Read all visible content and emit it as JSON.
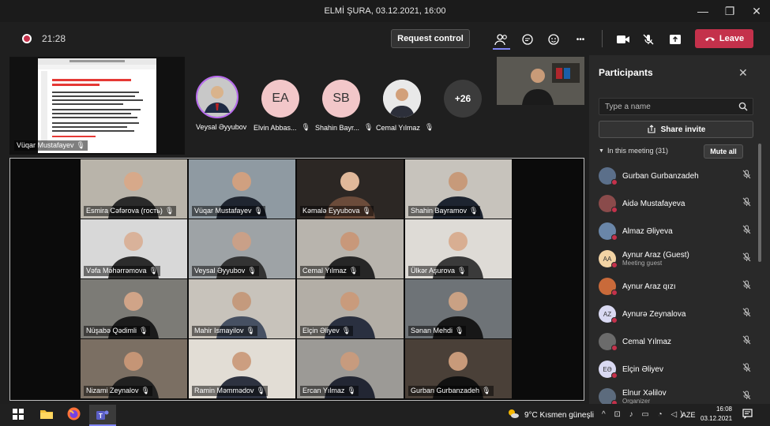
{
  "window": {
    "title": "ELMİ ŞURA, 03.12.2021, 16:00"
  },
  "toolbar": {
    "timer": "21:28",
    "request_control": "Request control",
    "more": "•••",
    "leave": "Leave"
  },
  "share": {
    "presenter": "Vüqar Mustafayev"
  },
  "top_row": [
    {
      "name": "Veysal Əyyubov"
    },
    {
      "initials": "EA",
      "name": "Elvin Abbas..."
    },
    {
      "initials": "SB",
      "name": "Shahin Bayr..."
    },
    {
      "name": "Cemal Yılmaz"
    }
  ],
  "overflow_count": "+26",
  "grid": [
    "Esmira Cəfərova (гость)",
    "Vüqar Mustafayev",
    "Kəmalə Eyyubova",
    "Shahin Bayramov",
    "Vəfa Məhərrəmova",
    "Veysal Əyyubov",
    "Cemal Yılmaz",
    "Ülkər Aşurova",
    "Nüşabə Qədimli",
    "Mahir Ismayilov",
    "Elçin Əliyev",
    "Sənan Mehdi",
    "Nizami Zeynalov",
    "Ramin Məmmədov",
    "Ercan Yılmaz",
    "Gurban Gurbanzadeh"
  ],
  "panel": {
    "title": "Participants",
    "search_placeholder": "Type a name",
    "share_invite": "Share invite",
    "in_meeting": "In this meeting (31)",
    "mute_all": "Mute all",
    "participants": [
      {
        "name": "Gurban Gurbanzadeh",
        "sub": ""
      },
      {
        "name": "Aidə Mustafayeva",
        "sub": ""
      },
      {
        "name": "Almaz Əliyeva",
        "sub": ""
      },
      {
        "name": "Aynur Araz (Guest)",
        "sub": "Meeting guest",
        "initials": "AA"
      },
      {
        "name": "Aynur Araz qızı",
        "sub": ""
      },
      {
        "name": "Aynurə Zeynalova",
        "sub": "",
        "initials": "AZ"
      },
      {
        "name": "Cemal Yılmaz",
        "sub": ""
      },
      {
        "name": "Elçin Əliyev",
        "sub": "",
        "initials": "EƏ"
      },
      {
        "name": "Elnur Xəlilov",
        "sub": "Organizer"
      }
    ]
  },
  "taskbar": {
    "weather": "9°C  Kısmen güneşli",
    "lang": "AZE",
    "time": "16:08",
    "date": "03.12.2021"
  },
  "colors": {
    "leave": "#c4314b",
    "accent": "#6264a7",
    "bg": "#1f1f1f",
    "panel": "#292929"
  }
}
